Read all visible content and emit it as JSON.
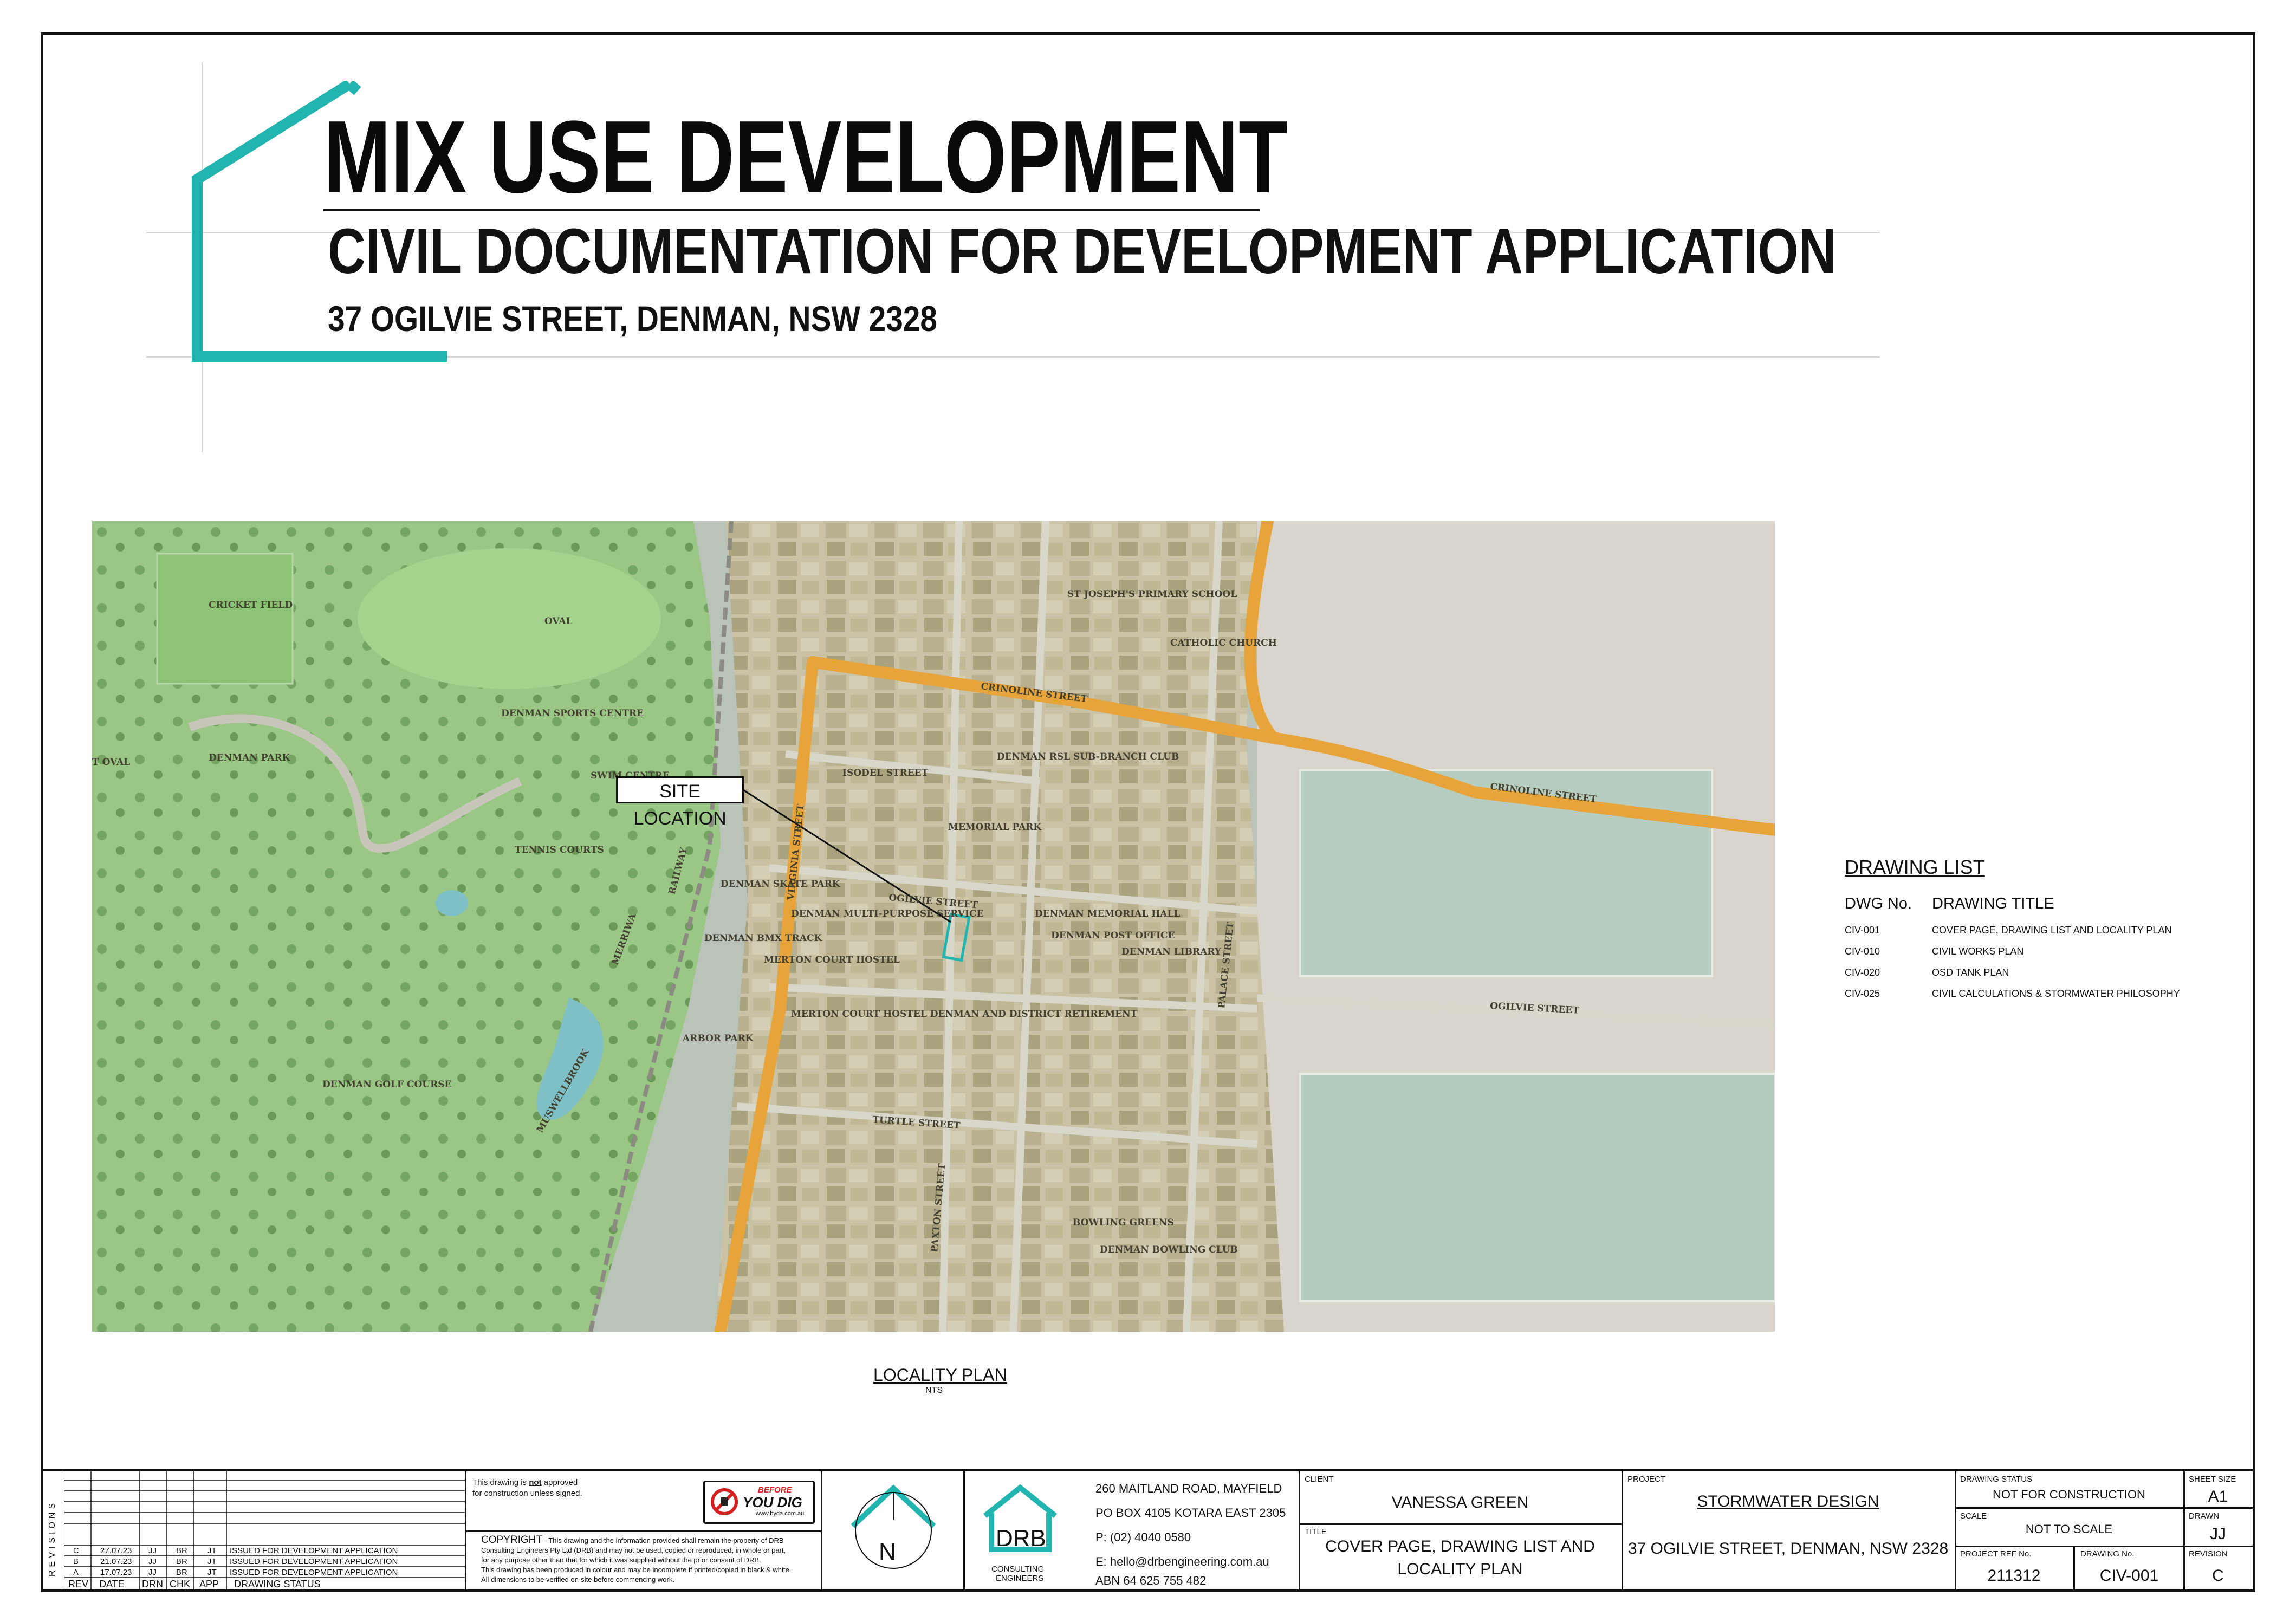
{
  "header": {
    "title": "MIX USE DEVELOPMENT",
    "subtitle": "CIVIL DOCUMENTATION FOR DEVELOPMENT APPLICATION",
    "address": "37 OGILVIE STREET, DENMAN, NSW 2328"
  },
  "colors": {
    "brand_teal": "#22b5b0",
    "road_orange": "#e6a43a",
    "grass_green": "#9ac785"
  },
  "map": {
    "callout_label": "SITE LOCATION",
    "labels": [
      "CRICKET FIELD",
      "OVAL",
      "DENMAN SPORTS CENTRE",
      "DENMAN PARK",
      "T OVAL",
      "TENNIS COURTS",
      "DENMAN SKATE PARK",
      "DENMAN BMX TRACK",
      "ARBOR PARK",
      "DENMAN GOLF COURSE",
      "RAILWAY",
      "MERRIWA",
      "MUSWELLBROOK",
      "VIRGINIA STREET",
      "ISODEL STREET",
      "CRINOLINE STREET",
      "CRINOLINE STREET",
      "OGILVIE STREET",
      "OGILVIE STREET",
      "TURTLE STREET",
      "PAXTON STREET",
      "PALACE STREET",
      "MEMORIAL PARK",
      "DENMAN RSL SUB-BRANCH CLUB",
      "ST JOSEPH'S PRIMARY SCHOOL",
      "CATHOLIC CHURCH",
      "DENMAN MULTI-PURPOSE SERVICE",
      "MERTON COURT HOSTEL",
      "DENMAN MEMORIAL HALL",
      "DENMAN POST OFFICE",
      "DENMAN LIBRARY",
      "MERTON COURT HOSTEL DENMAN AND DISTRICT RETIREMENT",
      "BOWLING GREENS",
      "DENMAN BOWLING CLUB",
      "SWIM CENTRE"
    ]
  },
  "drawing_list": {
    "title": "DRAWING LIST",
    "col_no": "DWG No.",
    "col_title": "DRAWING TITLE",
    "rows": [
      {
        "no": "CIV-001",
        "title": "COVER PAGE, DRAWING LIST AND LOCALITY PLAN"
      },
      {
        "no": "CIV-010",
        "title": "CIVIL WORKS PLAN"
      },
      {
        "no": "CIV-020",
        "title": "OSD TANK PLAN"
      },
      {
        "no": "CIV-025",
        "title": "CIVIL CALCULATIONS & STORMWATER PHILOSOPHY"
      }
    ]
  },
  "locality": {
    "title": "LOCALITY PLAN",
    "scale": "NTS"
  },
  "revisions": {
    "side_label": "REVISIONS",
    "headers": [
      "REV",
      "DATE",
      "DRN",
      "CHK",
      "APP",
      "DRAWING STATUS"
    ],
    "rows": [
      {
        "rev": "C",
        "date": "27.07.23",
        "drn": "JJ",
        "chk": "BR",
        "app": "JT",
        "status": "ISSUED FOR DEVELOPMENT APPLICATION"
      },
      {
        "rev": "B",
        "date": "21.07.23",
        "drn": "JJ",
        "chk": "BR",
        "app": "JT",
        "status": "ISSUED FOR DEVELOPMENT APPLICATION"
      },
      {
        "rev": "A",
        "date": "17.07.23",
        "drn": "JJ",
        "chk": "BR",
        "app": "JT",
        "status": "ISSUED FOR DEVELOPMENT APPLICATION"
      }
    ]
  },
  "notes": {
    "approval_line1a": "This drawing is ",
    "approval_not": "not",
    "approval_line1b": " approved",
    "approval_line2": "for construction unless signed.",
    "copyright_heading": "COPYRIGHT",
    "copyright_text1": " - This drawing and the information provided shall remain the property of DRB",
    "copyright_text2": "Consulting Engineers Pty Ltd (DRB) and may not be used, copied or reproduced, in whole or part,",
    "copyright_text3": "for any purpose other than that for which it was supplied without the prior consent of DRB.",
    "copyright_text4": "This drawing has been produced in colour and may be incomplete if printed/copied in black & white.",
    "copyright_text5": "All dimensions to be verified on-site before commencing work.",
    "byda_line1": "BEFORE",
    "byda_line2": "YOU DIG",
    "byda_url": "www.byda.com.au"
  },
  "north": {
    "label": "N"
  },
  "company": {
    "logo_text": "DRB",
    "logo_sub1": "CONSULTING",
    "logo_sub2": "ENGINEERS",
    "address1": "260 MAITLAND ROAD, MAYFIELD",
    "address2": "PO BOX 4105 KOTARA EAST 2305",
    "phone": "P: (02) 4040 0580",
    "email": "E: hello@drbengineering.com.au",
    "abn": "ABN 64 625 755 482"
  },
  "client": {
    "label": "CLIENT",
    "value": "VANESSA GREEN"
  },
  "title_field": {
    "label": "TITLE",
    "line1": "COVER PAGE, DRAWING LIST AND",
    "line2": "LOCALITY PLAN"
  },
  "project": {
    "label": "PROJECT",
    "value": "STORMWATER DESIGN",
    "address": "37 OGILVIE STREET, DENMAN, NSW 2328"
  },
  "drawing_status": {
    "label": "DRAWING STATUS",
    "value": "NOT FOR CONSTRUCTION"
  },
  "scale": {
    "label": "SCALE",
    "value": "NOT TO SCALE"
  },
  "project_ref": {
    "label": "PROJECT REF No.",
    "value": "211312"
  },
  "drawing_no": {
    "label": "DRAWING No.",
    "value": "CIV-001"
  },
  "sheet_size": {
    "label": "SHEET SIZE",
    "value": "A1"
  },
  "drawn": {
    "label": "DRAWN",
    "value": "JJ"
  },
  "revision": {
    "label": "REVISION",
    "value": "C"
  }
}
